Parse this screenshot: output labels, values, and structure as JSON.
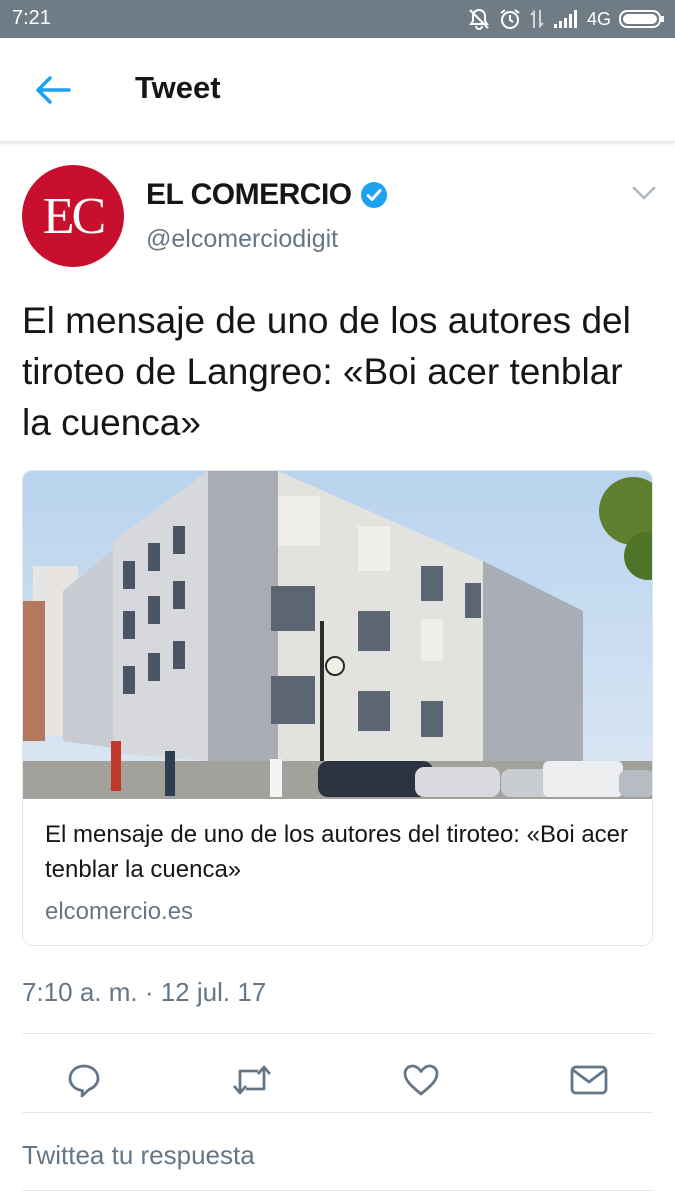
{
  "status_bar": {
    "time": "7:21",
    "network": "4G",
    "background_color": "#6f7c86",
    "icons": [
      "muted-bell-icon",
      "alarm-icon",
      "data-transfer-icon",
      "signal-icon",
      "battery-icon"
    ]
  },
  "header": {
    "title": "Tweet",
    "back_icon": "back-arrow-icon",
    "accent_color": "#1da1f2"
  },
  "tweet": {
    "author": {
      "avatar_text": "EC",
      "avatar_color": "#c8102e",
      "name": "EL COMERCIO",
      "verified": true,
      "handle": "@elcomerciodigit"
    },
    "text": "El mensaje de uno de los autores del tiroteo de Langreo: «Boi acer tenblar la cuenca»",
    "card": {
      "title": "El mensaje de uno de los autores del tiroteo: «Boi acer tenblar la cuenca»",
      "domain": "elcomercio.es",
      "image_subject": "building-photo"
    },
    "timestamp": "7:10 a. m. · 12 jul. 17",
    "actions": [
      "reply-icon",
      "retweet-icon",
      "like-icon",
      "share-icon"
    ]
  },
  "reply": {
    "placeholder": "Twittea tu respuesta"
  }
}
